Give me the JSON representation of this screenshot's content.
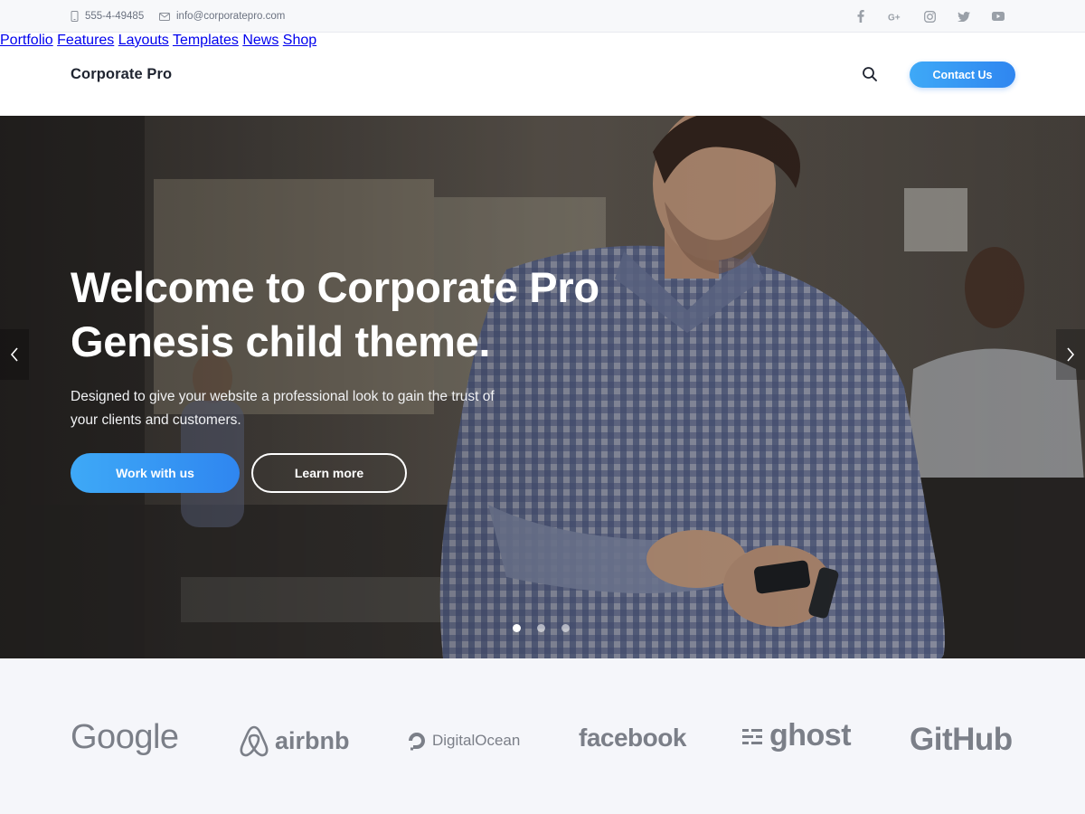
{
  "topbar": {
    "phone": "555-4-49485",
    "email": "info@corporatepro.com",
    "social": [
      "facebook-icon",
      "google-plus-icon",
      "instagram-icon",
      "twitter-icon",
      "youtube-icon"
    ]
  },
  "header": {
    "logo": "Corporate Pro",
    "nav": [
      "Portfolio",
      "Features",
      "Layouts",
      "Templates",
      "News",
      "Shop"
    ],
    "contact_label": "Contact Us"
  },
  "hero": {
    "title_line1": "Welcome to Corporate Pro",
    "title_line2": "Genesis child theme.",
    "subtitle": "Designed to give your website a professional look to gain the trust of your clients and customers.",
    "primary_label": "Work with us",
    "secondary_label": "Learn more",
    "slides_total": 3,
    "active_slide": 1
  },
  "logos": {
    "google": "Google",
    "airbnb": "airbnb",
    "digitalocean": "DigitalOcean",
    "facebook": "facebook",
    "ghost": "ghost",
    "github": "GitHub"
  },
  "colors": {
    "accent_start": "#3ea9f7",
    "accent_end": "#2f86f0",
    "logo_gray": "#7b7f88"
  }
}
